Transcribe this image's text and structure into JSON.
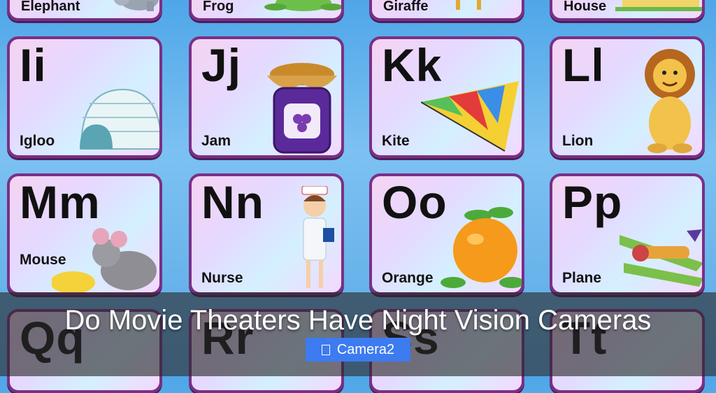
{
  "cards": {
    "row0": [
      "Elephant",
      "Frog",
      "Giraffe",
      "House"
    ],
    "row1": [
      {
        "letter": "Ii",
        "word": "Igloo"
      },
      {
        "letter": "Jj",
        "word": "Jam"
      },
      {
        "letter": "Kk",
        "word": "Kite"
      },
      {
        "letter": "Ll",
        "word": "Lion"
      }
    ],
    "row2": [
      {
        "letter": "Mm",
        "word": "Mouse"
      },
      {
        "letter": "Nn",
        "word": "Nurse"
      },
      {
        "letter": "Oo",
        "word": "Orange"
      },
      {
        "letter": "Pp",
        "word": "Plane"
      }
    ],
    "row3": [
      "Qq",
      "Rr",
      "Ss",
      "Tt"
    ]
  },
  "overlay": {
    "headline": "Do Movie Theaters Have Night Vision Cameras",
    "tag_label": "Camera2",
    "tag_icon": "document-icon"
  },
  "colors": {
    "card_border": "#7a2f86",
    "tag_bg": "#3d7bf0"
  }
}
